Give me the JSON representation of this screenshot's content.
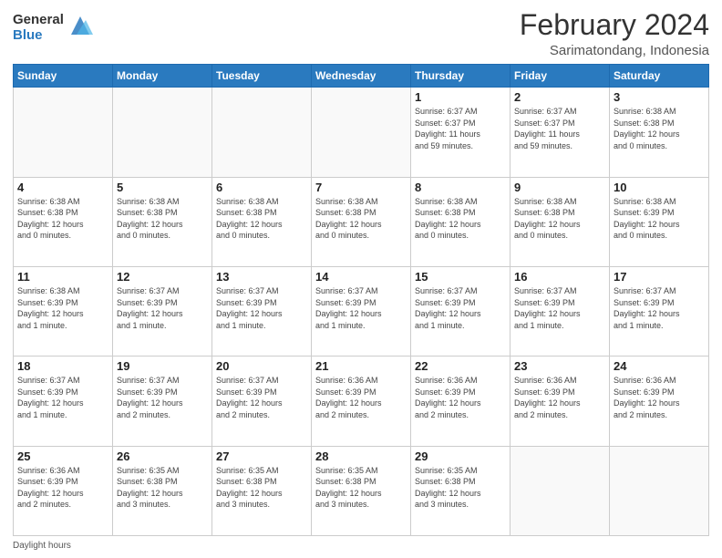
{
  "logo": {
    "general": "General",
    "blue": "Blue"
  },
  "header": {
    "month": "February 2024",
    "location": "Sarimatondang, Indonesia"
  },
  "weekdays": [
    "Sunday",
    "Monday",
    "Tuesday",
    "Wednesday",
    "Thursday",
    "Friday",
    "Saturday"
  ],
  "weeks": [
    [
      {
        "day": "",
        "info": ""
      },
      {
        "day": "",
        "info": ""
      },
      {
        "day": "",
        "info": ""
      },
      {
        "day": "",
        "info": ""
      },
      {
        "day": "1",
        "info": "Sunrise: 6:37 AM\nSunset: 6:37 PM\nDaylight: 11 hours\nand 59 minutes."
      },
      {
        "day": "2",
        "info": "Sunrise: 6:37 AM\nSunset: 6:37 PM\nDaylight: 11 hours\nand 59 minutes."
      },
      {
        "day": "3",
        "info": "Sunrise: 6:38 AM\nSunset: 6:38 PM\nDaylight: 12 hours\nand 0 minutes."
      }
    ],
    [
      {
        "day": "4",
        "info": "Sunrise: 6:38 AM\nSunset: 6:38 PM\nDaylight: 12 hours\nand 0 minutes."
      },
      {
        "day": "5",
        "info": "Sunrise: 6:38 AM\nSunset: 6:38 PM\nDaylight: 12 hours\nand 0 minutes."
      },
      {
        "day": "6",
        "info": "Sunrise: 6:38 AM\nSunset: 6:38 PM\nDaylight: 12 hours\nand 0 minutes."
      },
      {
        "day": "7",
        "info": "Sunrise: 6:38 AM\nSunset: 6:38 PM\nDaylight: 12 hours\nand 0 minutes."
      },
      {
        "day": "8",
        "info": "Sunrise: 6:38 AM\nSunset: 6:38 PM\nDaylight: 12 hours\nand 0 minutes."
      },
      {
        "day": "9",
        "info": "Sunrise: 6:38 AM\nSunset: 6:38 PM\nDaylight: 12 hours\nand 0 minutes."
      },
      {
        "day": "10",
        "info": "Sunrise: 6:38 AM\nSunset: 6:39 PM\nDaylight: 12 hours\nand 0 minutes."
      }
    ],
    [
      {
        "day": "11",
        "info": "Sunrise: 6:38 AM\nSunset: 6:39 PM\nDaylight: 12 hours\nand 1 minute."
      },
      {
        "day": "12",
        "info": "Sunrise: 6:37 AM\nSunset: 6:39 PM\nDaylight: 12 hours\nand 1 minute."
      },
      {
        "day": "13",
        "info": "Sunrise: 6:37 AM\nSunset: 6:39 PM\nDaylight: 12 hours\nand 1 minute."
      },
      {
        "day": "14",
        "info": "Sunrise: 6:37 AM\nSunset: 6:39 PM\nDaylight: 12 hours\nand 1 minute."
      },
      {
        "day": "15",
        "info": "Sunrise: 6:37 AM\nSunset: 6:39 PM\nDaylight: 12 hours\nand 1 minute."
      },
      {
        "day": "16",
        "info": "Sunrise: 6:37 AM\nSunset: 6:39 PM\nDaylight: 12 hours\nand 1 minute."
      },
      {
        "day": "17",
        "info": "Sunrise: 6:37 AM\nSunset: 6:39 PM\nDaylight: 12 hours\nand 1 minute."
      }
    ],
    [
      {
        "day": "18",
        "info": "Sunrise: 6:37 AM\nSunset: 6:39 PM\nDaylight: 12 hours\nand 1 minute."
      },
      {
        "day": "19",
        "info": "Sunrise: 6:37 AM\nSunset: 6:39 PM\nDaylight: 12 hours\nand 2 minutes."
      },
      {
        "day": "20",
        "info": "Sunrise: 6:37 AM\nSunset: 6:39 PM\nDaylight: 12 hours\nand 2 minutes."
      },
      {
        "day": "21",
        "info": "Sunrise: 6:36 AM\nSunset: 6:39 PM\nDaylight: 12 hours\nand 2 minutes."
      },
      {
        "day": "22",
        "info": "Sunrise: 6:36 AM\nSunset: 6:39 PM\nDaylight: 12 hours\nand 2 minutes."
      },
      {
        "day": "23",
        "info": "Sunrise: 6:36 AM\nSunset: 6:39 PM\nDaylight: 12 hours\nand 2 minutes."
      },
      {
        "day": "24",
        "info": "Sunrise: 6:36 AM\nSunset: 6:39 PM\nDaylight: 12 hours\nand 2 minutes."
      }
    ],
    [
      {
        "day": "25",
        "info": "Sunrise: 6:36 AM\nSunset: 6:39 PM\nDaylight: 12 hours\nand 2 minutes."
      },
      {
        "day": "26",
        "info": "Sunrise: 6:35 AM\nSunset: 6:38 PM\nDaylight: 12 hours\nand 3 minutes."
      },
      {
        "day": "27",
        "info": "Sunrise: 6:35 AM\nSunset: 6:38 PM\nDaylight: 12 hours\nand 3 minutes."
      },
      {
        "day": "28",
        "info": "Sunrise: 6:35 AM\nSunset: 6:38 PM\nDaylight: 12 hours\nand 3 minutes."
      },
      {
        "day": "29",
        "info": "Sunrise: 6:35 AM\nSunset: 6:38 PM\nDaylight: 12 hours\nand 3 minutes."
      },
      {
        "day": "",
        "info": ""
      },
      {
        "day": "",
        "info": ""
      }
    ]
  ],
  "footer": {
    "note": "Daylight hours"
  }
}
